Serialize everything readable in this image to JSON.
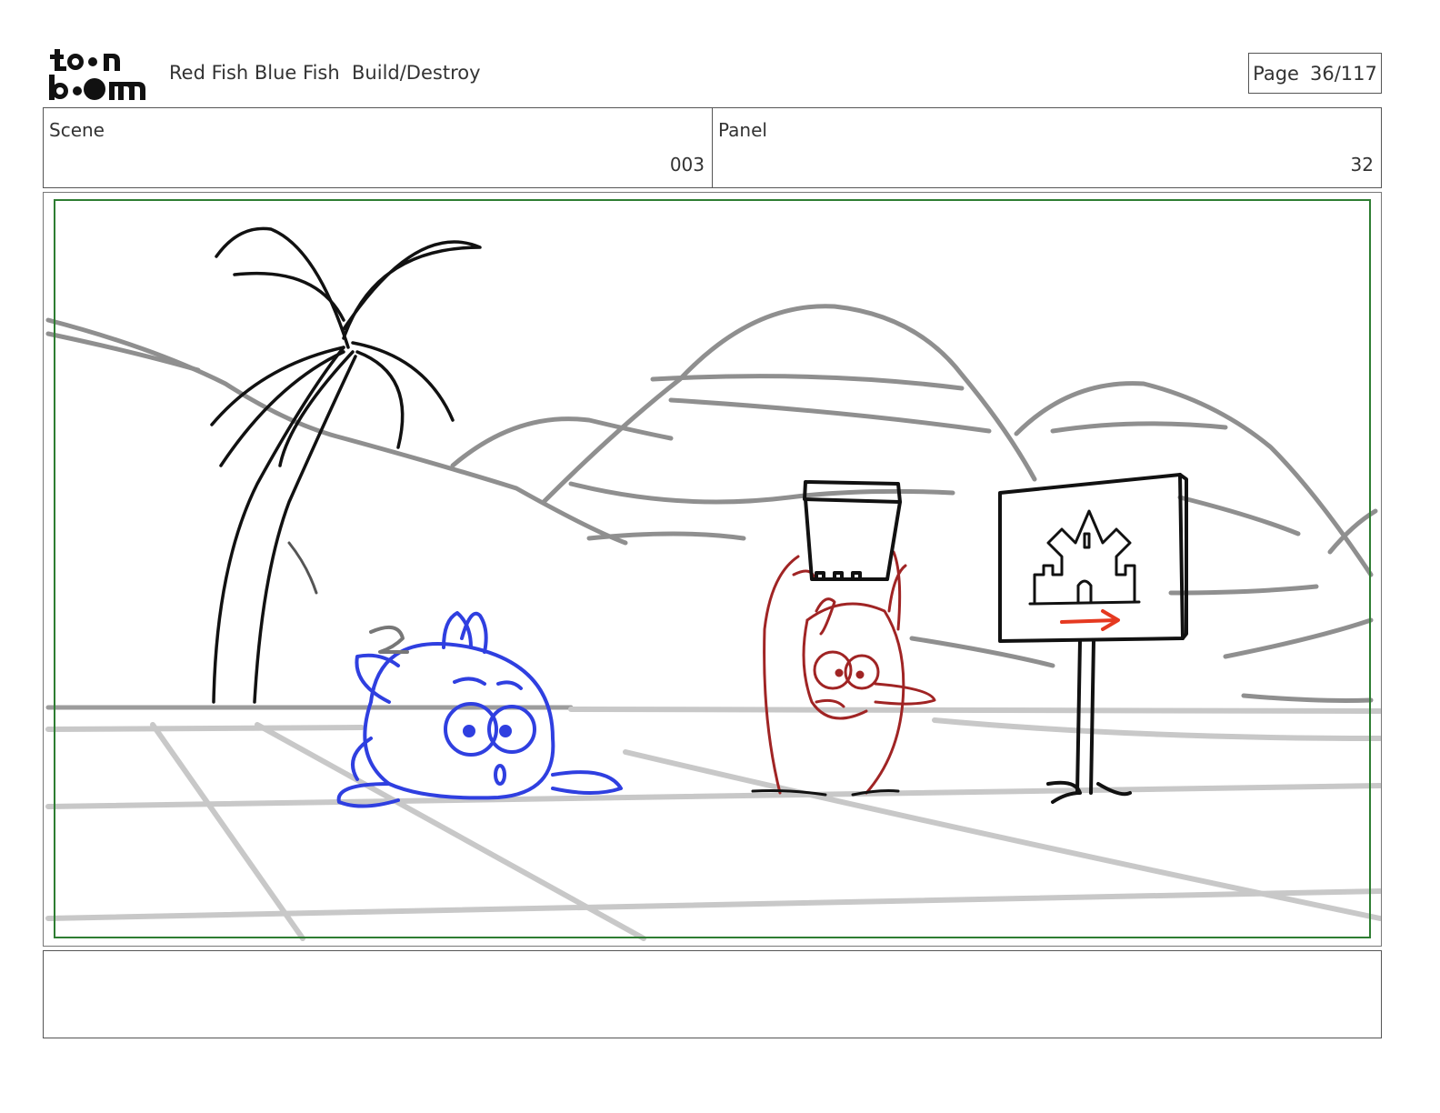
{
  "header": {
    "logo_text_top": "toon",
    "logo_text_bottom": "boom",
    "project_title": "Red Fish Blue Fish  Build/Destroy",
    "page_label": "Page",
    "page_value": "36/117"
  },
  "info": {
    "scene_label": "Scene",
    "scene_value": "003",
    "panel_label": "Panel",
    "panel_value": "32"
  },
  "colors": {
    "safe_frame": "#2e7d32",
    "blue_fish": "#2f3fe0",
    "red_fish": "#a02424",
    "arrow": "#e53920",
    "background_lines": "#8f8f8f"
  },
  "icons": {
    "logo": "toonboom-logo",
    "sign": "castle-sign-icon",
    "arrow": "arrow-right-icon"
  },
  "notes": {
    "text": ""
  }
}
